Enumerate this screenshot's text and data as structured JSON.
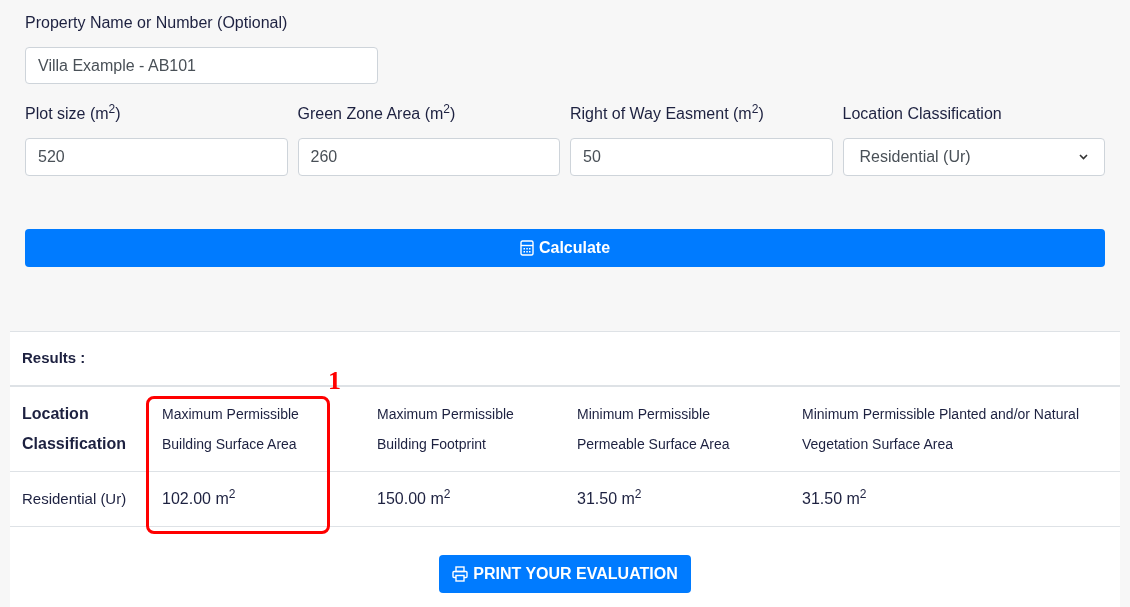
{
  "property_name": {
    "label": "Property Name or Number (Optional)",
    "value": "Villa Example - AB101"
  },
  "fields": [
    {
      "kind": "input",
      "label": "Plot size (m$^{2}$)",
      "value": "520"
    },
    {
      "kind": "input",
      "label": "Green Zone Area (m$^{2}$)",
      "value": "260"
    },
    {
      "kind": "input",
      "label": "Right of Way Easment (m$^{2}$)",
      "value": "50"
    },
    {
      "kind": "select",
      "label": "Location Classification",
      "value": "Residential (Ur)"
    }
  ],
  "calculate_button": "Calculate",
  "results": {
    "title": "Results :",
    "columns": [
      "Location Classification",
      "Maximum Permissible Building Surface Area",
      "Maximum Permissible Building Footprint",
      "Minimum Permissible Permeable Surface Area",
      "Minimum Permissible Planted and/or Natural Vegetation Surface Area"
    ],
    "rows": [
      [
        "Residential (Ur)",
        "102.00 m$^{2}$",
        "150.00 m$^{2}$",
        "31.50 m$^{2}$",
        "31.50 m$^{2}$"
      ]
    ]
  },
  "annotation": {
    "label": "1"
  },
  "print_button": "PRINT YOUR EVALUATION"
}
